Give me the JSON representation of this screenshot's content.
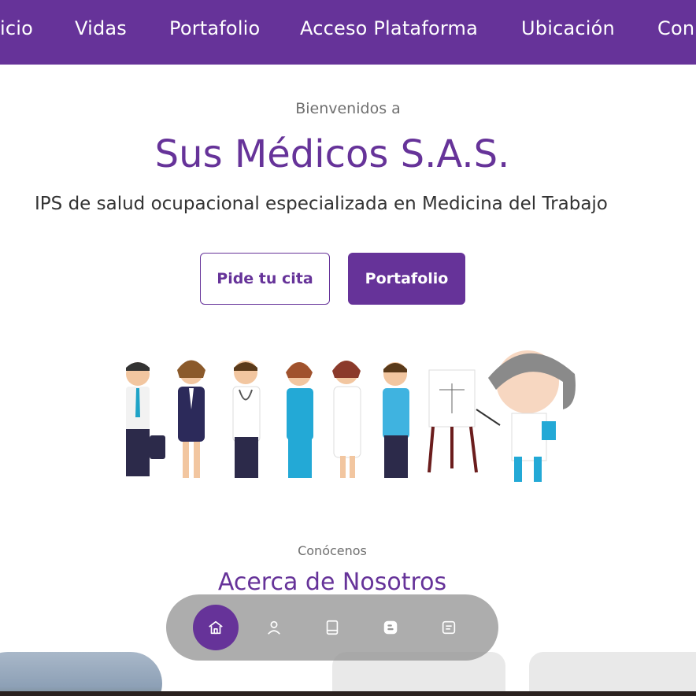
{
  "nav": {
    "items": [
      "icio",
      "Vidas",
      "Portafolio",
      "Acceso Plataforma",
      "Ubicación",
      "Con"
    ]
  },
  "hero": {
    "kicker": "Bienvenidos a",
    "title": "Sus Médicos S.A.S.",
    "subtitle": "IPS de salud ocupacional especializada en Medicina del Trabajo",
    "primary_button": "Pide tu cita",
    "secondary_button": "Portafolio"
  },
  "about": {
    "kicker": "Conócenos",
    "title": "Acerca de Nosotros"
  },
  "dock": {
    "items": [
      {
        "icon": "home-icon",
        "active": true
      },
      {
        "icon": "user-icon",
        "active": false
      },
      {
        "icon": "book-icon",
        "active": false
      },
      {
        "icon": "blogger-icon",
        "active": false
      },
      {
        "icon": "note-icon",
        "active": false
      }
    ]
  },
  "colors": {
    "brand": "#663399",
    "nav_text": "#ffffff",
    "dock_bg": "#969696"
  }
}
